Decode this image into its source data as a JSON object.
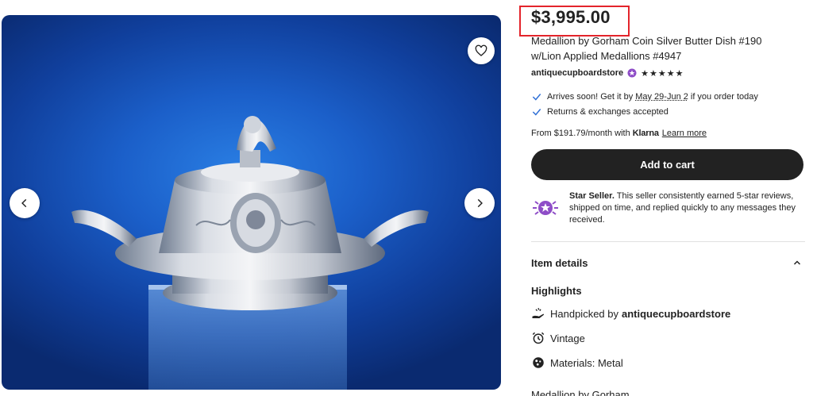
{
  "gallery": {
    "favorite_icon": "heart-icon",
    "prev_icon": "chevron-left-icon",
    "next_icon": "chevron-right-icon",
    "background_color": "#1b5fc9"
  },
  "listing": {
    "price": "$3,995.00",
    "title": "Medallion by Gorham Coin Silver Butter Dish #190 w/Lion Applied Medallions #4947",
    "seller": "antiquecupboardstore",
    "rating_stars": "★★★★★",
    "rating_value": 5,
    "delivery": {
      "prefix": "Arrives soon! Get it by",
      "dates": "May 29-Jun 2",
      "suffix": "if you order today"
    },
    "returns": "Returns & exchanges accepted",
    "klarna": {
      "prefix": "From $191.79/month with",
      "brand": "Klarna",
      "link": "Learn more"
    },
    "add_to_cart": "Add to cart",
    "star_seller": {
      "title": "Star Seller.",
      "body": "This seller consistently earned 5-star reviews, shipped on time, and replied quickly to any messages they received."
    }
  },
  "details": {
    "section_title": "Item details",
    "highlights_title": "Highlights",
    "handpicked_prefix": "Handpicked by",
    "handpicked_seller": "antiquecupboardstore",
    "vintage": "Vintage",
    "materials": "Materials: Metal",
    "more_title": "Medallion by Gorham"
  },
  "colors": {
    "accent_dark": "#222222",
    "check_blue": "#2f6fd6",
    "star_seller_purple": "#8e4dc7",
    "highlight_border": "#e3242b"
  }
}
